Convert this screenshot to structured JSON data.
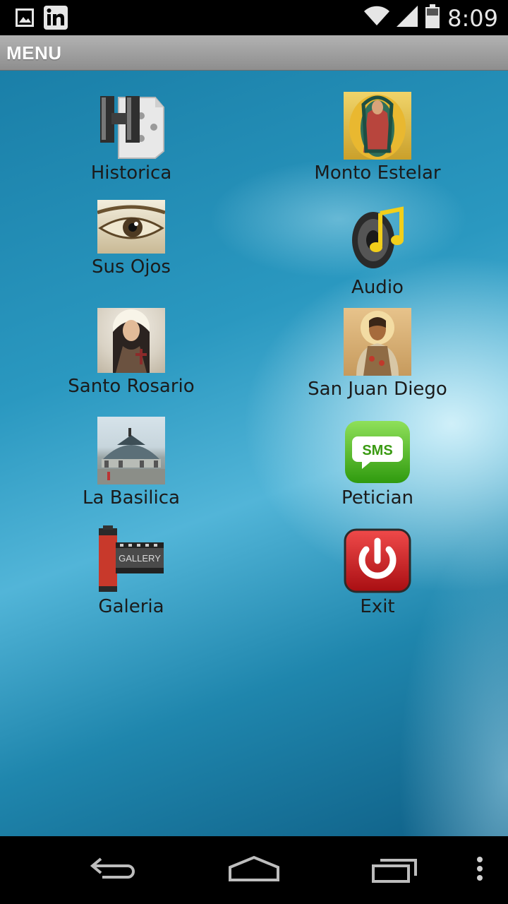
{
  "status_bar": {
    "time": "8:09",
    "left_icons": [
      "gallery-icon",
      "linkedin-icon"
    ],
    "right_icons": [
      "wifi-icon",
      "signal-icon",
      "battery-icon"
    ]
  },
  "action_bar": {
    "title": "MENU"
  },
  "menu": {
    "items": [
      {
        "label": "Historica",
        "icon": "historica-icon"
      },
      {
        "label": "Monto Estelar",
        "icon": "virgin-guadalupe-icon"
      },
      {
        "label": "Sus Ojos",
        "icon": "eye-icon"
      },
      {
        "label": "Audio",
        "icon": "speaker-music-icon"
      },
      {
        "label": "Santo Rosario",
        "icon": "saint-icon"
      },
      {
        "label": "San Juan Diego",
        "icon": "san-juan-diego-icon"
      },
      {
        "label": "La Basilica",
        "icon": "basilica-icon"
      },
      {
        "label": "Petician",
        "icon": "sms-icon"
      },
      {
        "label": "Galeria",
        "icon": "film-gallery-icon"
      },
      {
        "label": "Exit",
        "icon": "power-icon"
      }
    ],
    "sms_badge": "SMS",
    "gallery_text": "GALLERY"
  },
  "nav_bar": {
    "buttons": [
      "back-icon",
      "home-icon",
      "recents-icon",
      "overflow-menu-icon"
    ]
  },
  "colors": {
    "accent_blue": "#2a98c0",
    "action_bar": "#a0a0a0",
    "sms_green": "#49b514",
    "exit_red": "#d0181d"
  }
}
